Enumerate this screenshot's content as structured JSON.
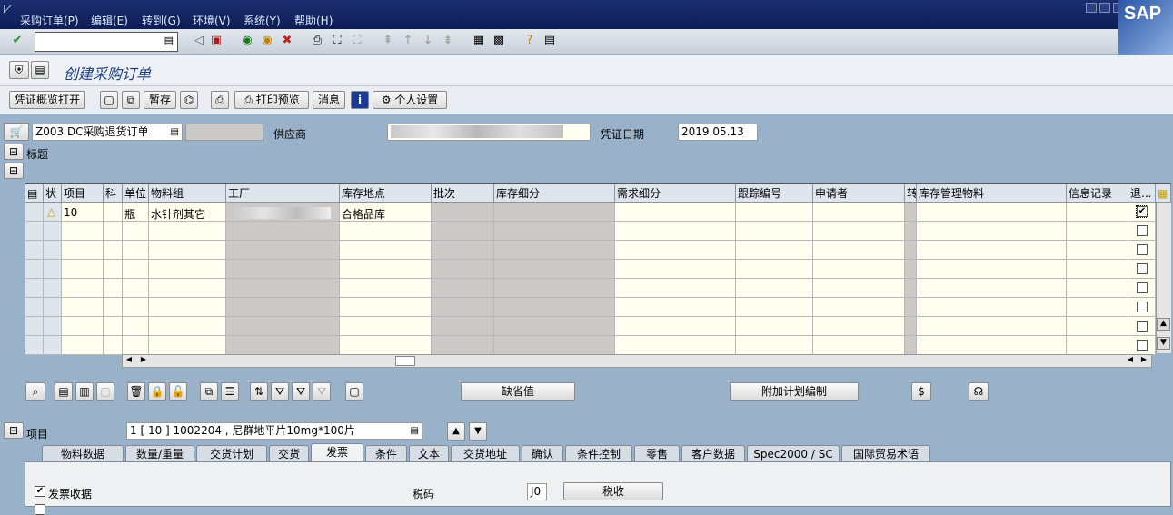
{
  "menu": [
    "采购订单(P)",
    "编辑(E)",
    "转到(G)",
    "环境(V)",
    "系统(Y)",
    "帮助(H)"
  ],
  "sap_logo": "SAP",
  "page_title": "创建采购订单",
  "app_toolbar": {
    "overview_open": "凭证概览打开",
    "hold": "暂存",
    "print_preview": "打印预览",
    "messages": "消息",
    "personal_settings": "个人设置"
  },
  "header": {
    "doc_type": "Z003 DC采购退货订单",
    "vendor_label": "供应商",
    "doc_date_label": "凭证日期",
    "doc_date": "2019.05.13",
    "header_label": "标题"
  },
  "grid": {
    "columns": [
      "状",
      "项目",
      "科",
      "单位",
      "物料组",
      "工厂",
      "库存地点",
      "批次",
      "库存细分",
      "需求细分",
      "跟踪编号",
      "申请者",
      "转",
      "库存管理物料",
      "信息记录",
      "退..."
    ],
    "rows": [
      {
        "item": "10",
        "unit": "瓶",
        "matl_group": "水针剂其它",
        "stor_loc": "合格品库",
        "returns": true
      }
    ]
  },
  "grid_buttons": {
    "defaults": "缺省值",
    "addl_planning": "附加计划编制"
  },
  "item_selector": {
    "label": "项目",
    "value": "1 [ 10 ] 1002204 , 尼群地平片10mg*100片"
  },
  "tabs": [
    "物料数据",
    "数量/重量",
    "交货计划",
    "交货",
    "发票",
    "条件",
    "文本",
    "交货地址",
    "确认",
    "条件控制",
    "零售",
    "客户数据",
    "Spec2000 / SC",
    "国际贸易术语"
  ],
  "active_tab": "发票",
  "invoice_tab": {
    "inv_receipt_label": "发票收据",
    "tax_code_label": "税码",
    "tax_code": "J0",
    "taxes_button": "税收"
  }
}
